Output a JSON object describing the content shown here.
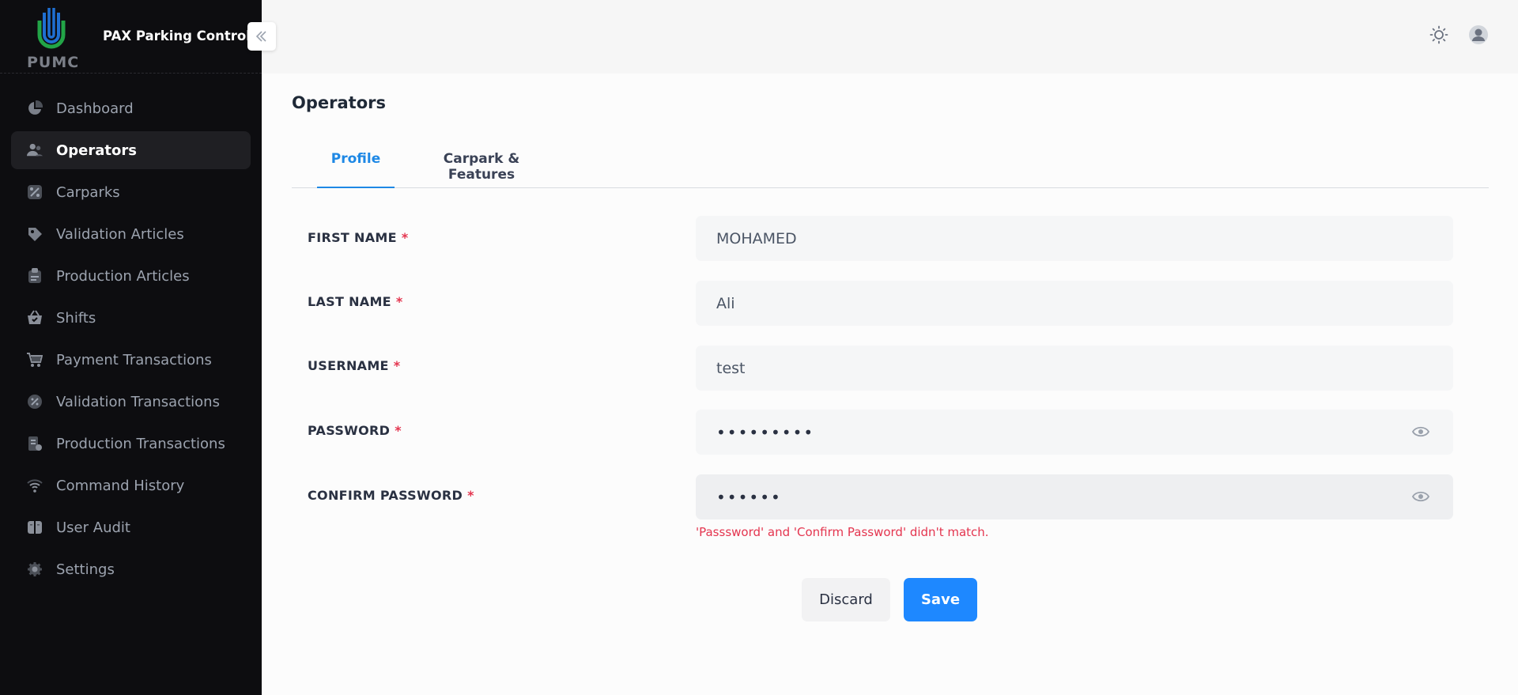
{
  "brand": {
    "logo_text": "PUMC",
    "app_name": "PAX Parking Control"
  },
  "sidebar": {
    "items": [
      {
        "label": "Dashboard",
        "icon": "pie-chart-icon"
      },
      {
        "label": "Operators",
        "icon": "users-icon",
        "active": true
      },
      {
        "label": "Carparks",
        "icon": "percent-tag-icon"
      },
      {
        "label": "Validation Articles",
        "icon": "tag-icon"
      },
      {
        "label": "Production Articles",
        "icon": "receipt-icon"
      },
      {
        "label": "Shifts",
        "icon": "basket-icon"
      },
      {
        "label": "Payment Transactions",
        "icon": "cart-icon"
      },
      {
        "label": "Validation Transactions",
        "icon": "discount-badge-icon"
      },
      {
        "label": "Production Transactions",
        "icon": "document-icon"
      },
      {
        "label": "Command History",
        "icon": "wifi-icon"
      },
      {
        "label": "User Audit",
        "icon": "book-icon"
      },
      {
        "label": "Settings",
        "icon": "gear-icon"
      }
    ]
  },
  "header": {
    "theme_icon": "sun-icon",
    "user_icon": "user-avatar-icon"
  },
  "page": {
    "title": "Operators",
    "tabs": [
      {
        "label": "Profile",
        "active": true
      },
      {
        "label": "Carpark & Features"
      }
    ]
  },
  "form": {
    "first_name": {
      "label": "FIRST NAME",
      "value": "MOHAMED"
    },
    "last_name": {
      "label": "LAST NAME",
      "value": "Ali"
    },
    "username": {
      "label": "USERNAME",
      "value": "test"
    },
    "password": {
      "label": "PASSWORD",
      "value": "•••••••••"
    },
    "confirm_password": {
      "label": "CONFIRM PASSWORD",
      "value": "••••••"
    },
    "required_mark": "*",
    "error": "'Passsword' and 'Confirm Password' didn't match."
  },
  "actions": {
    "discard_label": "Discard",
    "save_label": "Save"
  },
  "colors": {
    "sidebar_bg": "#0d0d10",
    "accent": "#1e88ff",
    "error": "#e4354f",
    "logo_blue": "#1f6fd1",
    "logo_green": "#22a447"
  }
}
